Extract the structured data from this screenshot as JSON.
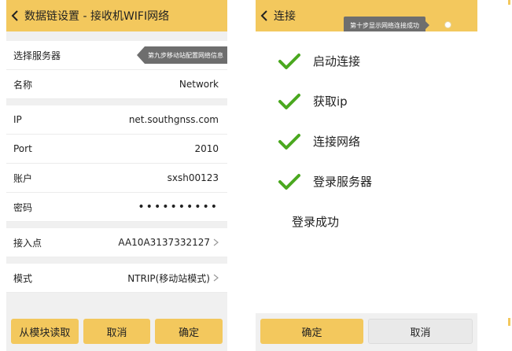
{
  "left": {
    "title": "数据链设置 - 接收机WIFI网络",
    "tooltip": "第九步移动站配置网络信息",
    "rows": {
      "server": {
        "label": "选择服务器"
      },
      "name": {
        "label": "名称",
        "value": "Network"
      },
      "ip": {
        "label": "IP",
        "value": "net.southgnss.com"
      },
      "port": {
        "label": "Port",
        "value": "2010"
      },
      "account": {
        "label": "账户",
        "value": "sxsh00123"
      },
      "password": {
        "label": "密码",
        "value": "••••••••••"
      },
      "mountpoint": {
        "label": "接入点",
        "value": "AA10A3137332127"
      },
      "mode": {
        "label": "模式",
        "value": "NTRIP(移动站模式)"
      }
    },
    "buttons": {
      "read": "从模块读取",
      "cancel": "取消",
      "ok": "确定"
    }
  },
  "right": {
    "title": "连接",
    "tooltip": "第十步显示网络连接成功",
    "steps": [
      "启动连接",
      "获取ip",
      "连接网络",
      "登录服务器"
    ],
    "result": "登录成功",
    "buttons": {
      "ok": "确定",
      "cancel": "取消"
    }
  },
  "colors": {
    "accent": "#f3c85d",
    "check": "#4aa81f",
    "tooltip": "#6e6e6e"
  },
  "icons": {
    "back": "chevron-left-icon",
    "next": "chevron-right-icon",
    "step": "check-icon"
  }
}
